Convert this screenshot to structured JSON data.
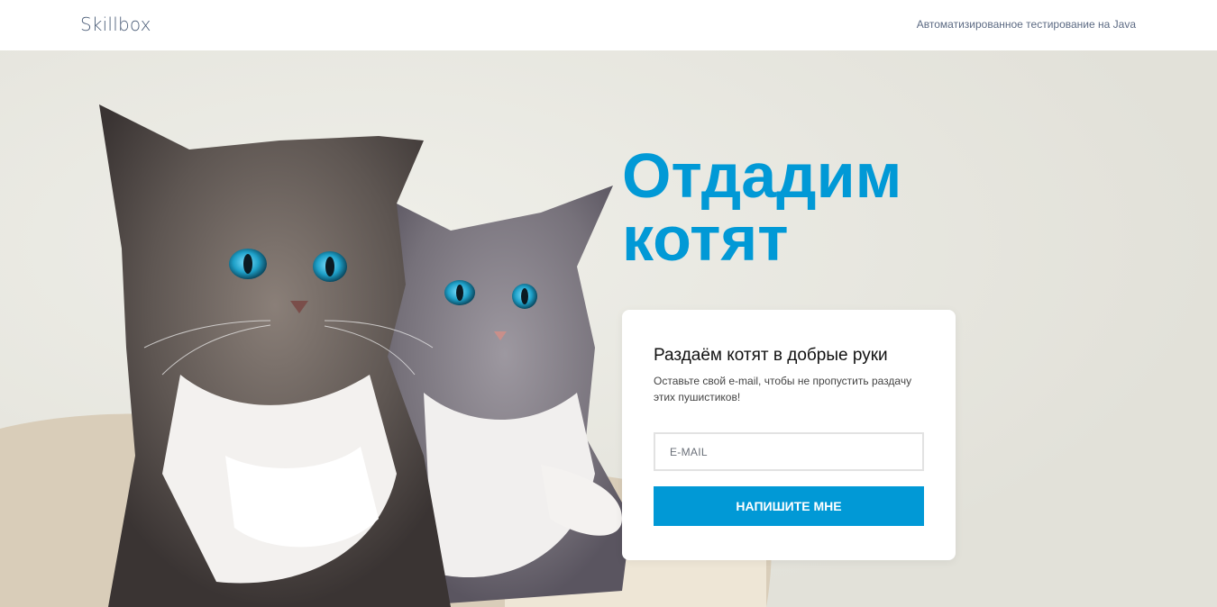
{
  "header": {
    "logo": "Skillbox",
    "course_link": "Автоматизированное тестирование на Java"
  },
  "hero": {
    "headline_line1": "Отдадим",
    "headline_line2": "котят",
    "image_subject": "two fluffy tabby kittens with blue eyes"
  },
  "form": {
    "title": "Раздаём котят в добрые руки",
    "description": "Оставьте свой e-mail, чтобы не пропустить раздачу этих пушистиков!",
    "email_placeholder": "E-MAIL",
    "email_value": "",
    "submit_label": "НАПИШИТЕ МНЕ"
  },
  "colors": {
    "accent": "#0199d6",
    "header_bg": "#ffffff",
    "logo_text": "#4b5d78"
  }
}
